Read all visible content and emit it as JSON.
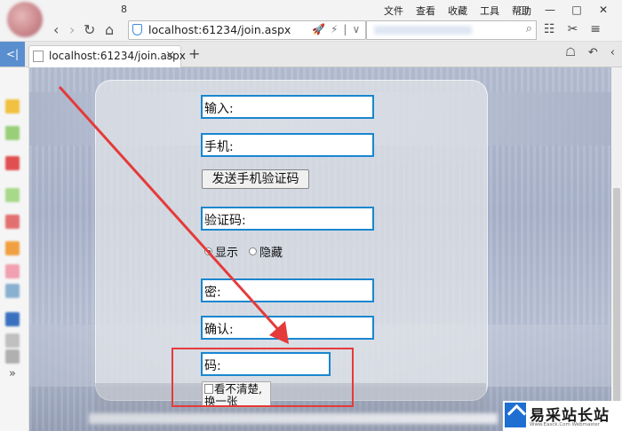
{
  "titlebar": {
    "tab_count": "8",
    "menu": [
      "文件",
      "查看",
      "收藏",
      "工具",
      "帮助"
    ],
    "window_controls": [
      "□",
      "—",
      "□",
      "✕"
    ]
  },
  "navbar": {
    "back": "‹",
    "forward": "›",
    "reload": "↻",
    "home": "⌂",
    "url": "localhost:61234/join.aspx",
    "url_tools": [
      "🚀",
      "⚡",
      "|",
      "∨"
    ],
    "search_icon": "⌕",
    "right_tools": [
      "☷",
      "✂",
      "≡"
    ]
  },
  "tabbar": {
    "back_label": "<|",
    "tab_title": "localhost:61234/join.aspx",
    "tab_close": "×",
    "add": "+",
    "right_tools": [
      "☖",
      "↶",
      "‹"
    ]
  },
  "sidebar": {
    "more": "»",
    "icons": [
      {
        "name": "folder-icon",
        "color": "#f0c040"
      },
      {
        "name": "leaf-icon",
        "color": "#9acf7a"
      },
      {
        "name": "red-app-icon",
        "color": "#e05050"
      },
      {
        "name": "green-app-icon",
        "color": "#a8d88a"
      },
      {
        "name": "red-app-icon-2",
        "color": "#e27070"
      },
      {
        "name": "multi-color-icon",
        "color": "#f0a040"
      },
      {
        "name": "pink-app-icon",
        "color": "#f0a0b0"
      },
      {
        "name": "circle-app-icon",
        "color": "#8ab0d0"
      },
      {
        "name": "film-icon",
        "color": "#3a70c0"
      },
      {
        "name": "note-icon",
        "color": "#c0c0c0"
      },
      {
        "name": "scroll-icon",
        "color": "#b0b0b0"
      }
    ]
  },
  "form": {
    "input_label": "输入:",
    "phone_label": "手机:",
    "send_sms_button": "发送手机验证码",
    "sms_code_label": "验证码:",
    "show_option": "显示",
    "hide_option": "隐藏",
    "password_label": "密:",
    "confirm_label": "确认:",
    "captcha_label": "码:",
    "captcha_image_alt_line1": "看不清楚,",
    "captcha_image_alt_line2": "换一张"
  },
  "colors": {
    "field_border": "#1a86d0",
    "highlight": "#e53a3a",
    "arrow": "#e53a3a"
  },
  "watermark": {
    "text": "易采站长站",
    "sub": "Www.Easck.Com Webmaster"
  }
}
